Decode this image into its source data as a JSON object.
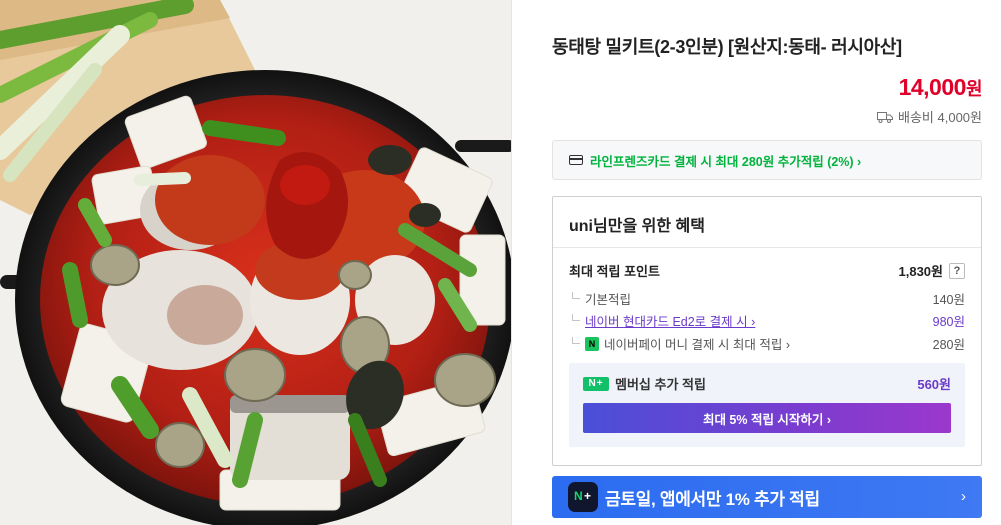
{
  "product": {
    "image_alt": "동태탕 밀키트",
    "title": "동태탕 밀키트(2-3인분) [원산지:동태- 러시아산]",
    "price_value": "14,000",
    "price_unit": "원",
    "shipping": "배송비 4,000원",
    "shipping_icon": "truck-icon"
  },
  "card_banner": {
    "text": "라인프렌즈카드 결제 시 최대 280원 추가적립 (2%) ›",
    "icon": "credit-card-icon",
    "color": "#00b33c"
  },
  "benefit": {
    "header_user": "uni",
    "header_rest": "님만을 위한 혜택",
    "max_points_label": "최대 적립 포인트",
    "max_points_value": "1,830원",
    "help_label": "?",
    "rows": [
      {
        "label": "기본적립",
        "value": "140원"
      },
      {
        "label": "네이버 현대카드 Ed2로 결제 시 ›",
        "value": "980원"
      },
      {
        "label": "네이버페이 머니 결제 시 최대 적립 ›",
        "value": "280원",
        "badge": "N"
      }
    ],
    "membership": {
      "badge": "N+",
      "label": "멤버십 추가 적립",
      "value": "560원",
      "button_label": "최대 5% 적립 시작하기 ›"
    }
  },
  "promo": {
    "badge_n": "N",
    "badge_plus": "+",
    "text": "금토일, 앱에서만 1% 추가 적립",
    "arrow": "›",
    "color": "#3f79f3"
  },
  "colors": {
    "price": "#e0002a",
    "accent_purple": "#6a3bc8",
    "naver_green": "#19c35d"
  }
}
